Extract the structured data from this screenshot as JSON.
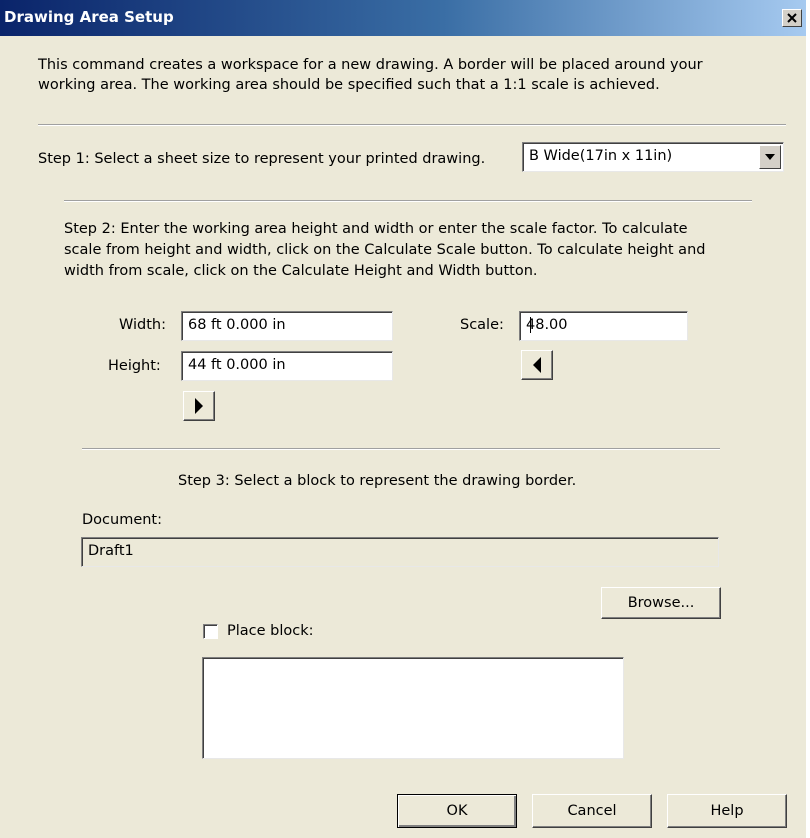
{
  "window": {
    "title": "Drawing Area Setup"
  },
  "intro": {
    "line1": "This command creates a workspace for a new drawing.  A border will be placed around your",
    "line2": "working area.  The working area should be specified such that a 1:1 scale is achieved."
  },
  "step1": {
    "label": "Step 1: Select a sheet size to represent your printed drawing.",
    "sheet_size_selected": "B Wide(17in x 11in)"
  },
  "step2": {
    "line1": "Step 2: Enter the working area height and width or enter the scale factor.  To calculate",
    "line2": "scale from height and width, click on the Calculate Scale button.  To calculate height and",
    "line3": "width from scale, click on the Calculate Height and Width button.",
    "width_label": "Width:",
    "width_value": "68 ft  0.000 in",
    "height_label": "Height:",
    "height_value": "44 ft  0.000 in",
    "scale_label": "Scale:",
    "scale_value": "48.00"
  },
  "step3": {
    "label": "Step 3: Select a block to represent the drawing border.",
    "document_label": "Document:",
    "document_value": "Draft1",
    "browse_label": "Browse...",
    "place_block_label": "Place block:",
    "place_block_checked": false
  },
  "footer": {
    "ok_label": "OK",
    "cancel_label": "Cancel",
    "help_label": "Help"
  },
  "icons": {
    "close": "close-icon",
    "dropdown": "chevron-down-icon",
    "calculate_scale": "arrow-right-icon",
    "calculate_height_width": "arrow-left-icon"
  },
  "colors": {
    "title_bar": "#0a246a",
    "dialog_face": "#ece9d8"
  }
}
